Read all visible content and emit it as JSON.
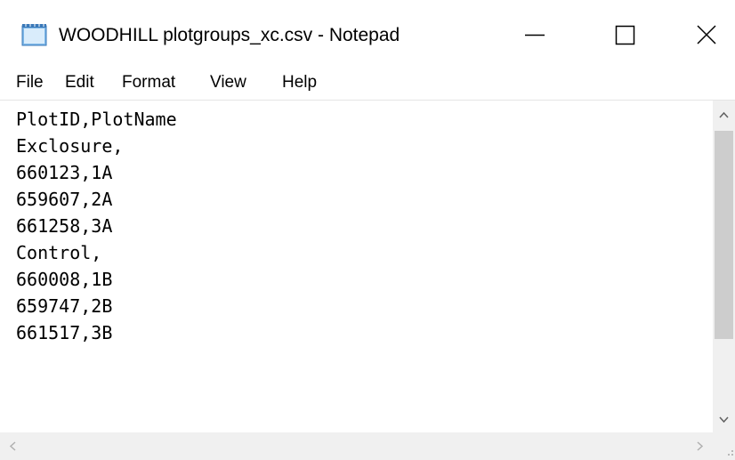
{
  "window": {
    "title": "WOODHILL plotgroups_xc.csv - Notepad",
    "icons": {
      "app": "notepad-icon",
      "minimize": "minimize-icon",
      "maximize": "maximize-icon",
      "close": "close-icon"
    }
  },
  "menu": {
    "file": "File",
    "edit": "Edit",
    "format": "Format",
    "view": "View",
    "help": "Help"
  },
  "document": {
    "lines": [
      "PlotID,PlotName",
      "Exclosure,",
      "660123,1A",
      "659607,2A",
      "661258,3A",
      "Control,",
      "660008,1B",
      "659747,2B",
      "661517,3B"
    ]
  },
  "colors": {
    "window_bg": "#ffffff",
    "scrollbar_track": "#f0f0f0",
    "scrollbar_thumb": "#cdcdcd",
    "arrow": "#606060"
  }
}
